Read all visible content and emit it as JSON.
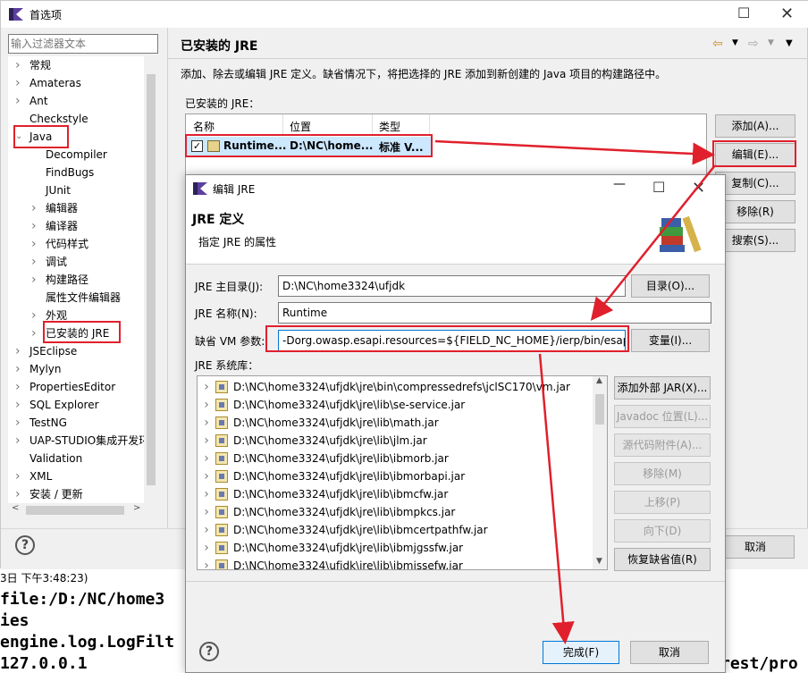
{
  "console": {
    "lines": [
      "3日 下午3:48:23)",
      "file:/D:/NC/home3",
      "ies",
      "engine.log.LogFilt",
      "    127.0.0.1",
      "rest/pro"
    ]
  },
  "prefs": {
    "title": "首选项",
    "filter_placeholder": "输入过滤器文本",
    "tree": [
      {
        "label": "常规",
        "indent": 0,
        "arrow": ">"
      },
      {
        "label": "Amateras",
        "indent": 0,
        "arrow": ">"
      },
      {
        "label": "Ant",
        "indent": 0,
        "arrow": ">"
      },
      {
        "label": "Checkstyle",
        "indent": 0,
        "arrow": ""
      },
      {
        "label": "Java",
        "indent": 0,
        "arrow": "v"
      },
      {
        "label": "Decompiler",
        "indent": 1,
        "arrow": ""
      },
      {
        "label": "FindBugs",
        "indent": 1,
        "arrow": ""
      },
      {
        "label": "JUnit",
        "indent": 1,
        "arrow": ""
      },
      {
        "label": "编辑器",
        "indent": 1,
        "arrow": ">"
      },
      {
        "label": "编译器",
        "indent": 1,
        "arrow": ">"
      },
      {
        "label": "代码样式",
        "indent": 1,
        "arrow": ">"
      },
      {
        "label": "调试",
        "indent": 1,
        "arrow": ">"
      },
      {
        "label": "构建路径",
        "indent": 1,
        "arrow": ">"
      },
      {
        "label": "属性文件编辑器",
        "indent": 1,
        "arrow": ""
      },
      {
        "label": "外观",
        "indent": 1,
        "arrow": ">"
      },
      {
        "label": "已安装的 JRE",
        "indent": 1,
        "arrow": ">"
      },
      {
        "label": "JSEclipse",
        "indent": 0,
        "arrow": ">"
      },
      {
        "label": "Mylyn",
        "indent": 0,
        "arrow": ">"
      },
      {
        "label": "PropertiesEditor",
        "indent": 0,
        "arrow": ">"
      },
      {
        "label": "SQL Explorer",
        "indent": 0,
        "arrow": ">"
      },
      {
        "label": "TestNG",
        "indent": 0,
        "arrow": ">"
      },
      {
        "label": "UAP-STUDIO集成开发环",
        "indent": 0,
        "arrow": ">"
      },
      {
        "label": "Validation",
        "indent": 0,
        "arrow": ""
      },
      {
        "label": "XML",
        "indent": 0,
        "arrow": ">"
      },
      {
        "label": "安装 / 更新",
        "indent": 0,
        "arrow": ">"
      }
    ],
    "page_title": "已安装的 JRE",
    "description": "添加、除去或编辑 JRE 定义。缺省情况下，将把选择的 JRE 添加到新创建的 Java 项目的构建路径中。",
    "installed_label": "已安装的 JRE：",
    "columns": {
      "name": "名称",
      "location": "位置",
      "type": "类型"
    },
    "row": {
      "name": "Runtime...",
      "location": "D:\\NC\\home...",
      "type": "标准 V..."
    },
    "buttons": {
      "add": "添加(A)...",
      "edit": "编辑(E)...",
      "copy": "复制(C)...",
      "remove": "移除(R)",
      "search": "搜索(S)..."
    },
    "cancel": "取消"
  },
  "dialog": {
    "title": "编辑 JRE",
    "header_title": "JRE 定义",
    "header_sub": "指定 JRE 的属性",
    "home_label": "JRE 主目录(J):",
    "home_value": "D:\\NC\\home3324\\ufjdk",
    "dir_button": "目录(O)...",
    "name_label": "JRE 名称(N):",
    "name_value": "Runtime",
    "vm_label": "缺省 VM 参数:",
    "vm_value": "-Dorg.owasp.esapi.resources=${FIELD_NC_HOME}/ierp/bin/esapi",
    "var_button": "变量(I)...",
    "libs_label": "JRE 系统库：",
    "libs": [
      "D:\\NC\\home3324\\ufjdk\\jre\\bin\\compressedrefs\\jclSC170\\vm.jar",
      "D:\\NC\\home3324\\ufjdk\\jre\\lib\\se-service.jar",
      "D:\\NC\\home3324\\ufjdk\\jre\\lib\\math.jar",
      "D:\\NC\\home3324\\ufjdk\\jre\\lib\\jlm.jar",
      "D:\\NC\\home3324\\ufjdk\\jre\\lib\\ibmorb.jar",
      "D:\\NC\\home3324\\ufjdk\\jre\\lib\\ibmorbapi.jar",
      "D:\\NC\\home3324\\ufjdk\\jre\\lib\\ibmcfw.jar",
      "D:\\NC\\home3324\\ufjdk\\jre\\lib\\ibmpkcs.jar",
      "D:\\NC\\home3324\\ufjdk\\jre\\lib\\ibmcertpathfw.jar",
      "D:\\NC\\home3324\\ufjdk\\jre\\lib\\ibmjgssfw.jar",
      "D:\\NC\\home3324\\ufjdk\\jre\\lib\\ibmjssefw.jar"
    ],
    "lib_buttons": {
      "add_jar": "添加外部 JAR(X)...",
      "javadoc": "Javadoc 位置(L)...",
      "source": "源代码附件(A)...",
      "remove": "移除(M)",
      "up": "上移(P)",
      "down": "向下(D)",
      "restore": "恢复缺省值(R)"
    },
    "finish": "完成(F)",
    "cancel": "取消"
  },
  "colors": {
    "annotation_red": "#e0202c",
    "accent": "#0078d7"
  }
}
